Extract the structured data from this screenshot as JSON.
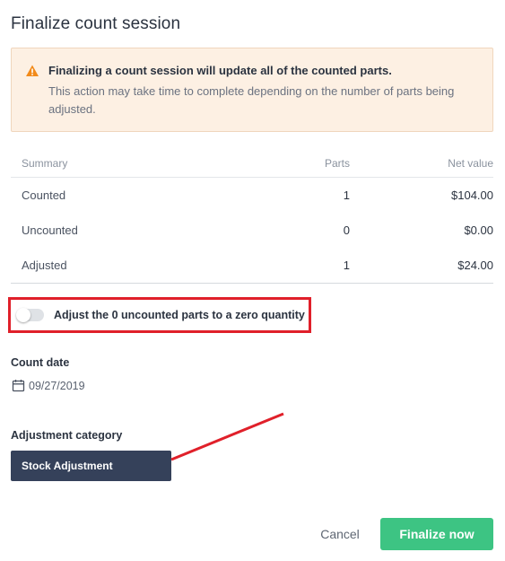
{
  "dialog": {
    "title": "Finalize count session"
  },
  "warning": {
    "heading": "Finalizing a count session will update all of the counted parts.",
    "body": "This action may take time to complete depending on the number of parts being adjusted.",
    "icon": "warning-triangle-icon",
    "icon_color": "#f28a1a"
  },
  "summary": {
    "headers": {
      "summary": "Summary",
      "parts": "Parts",
      "net_value": "Net value"
    },
    "rows": [
      {
        "label": "Counted",
        "parts": "1",
        "net_value": "$104.00"
      },
      {
        "label": "Uncounted",
        "parts": "0",
        "net_value": "$0.00"
      },
      {
        "label": "Adjusted",
        "parts": "1",
        "net_value": "$24.00"
      }
    ]
  },
  "adjust_toggle": {
    "label": "Adjust the 0 uncounted parts to a zero quantity",
    "checked": false
  },
  "count_date": {
    "label": "Count date",
    "value": "09/27/2019",
    "icon": "calendar-icon"
  },
  "adjustment_category": {
    "label": "Adjustment category",
    "selected": "Stock Adjustment"
  },
  "footer": {
    "cancel_label": "Cancel",
    "finalize_label": "Finalize now"
  },
  "colors": {
    "accent": "#3dc483",
    "annotation": "#e0202a",
    "select_bg": "#35415a",
    "warning_bg": "#fdf0e3"
  }
}
